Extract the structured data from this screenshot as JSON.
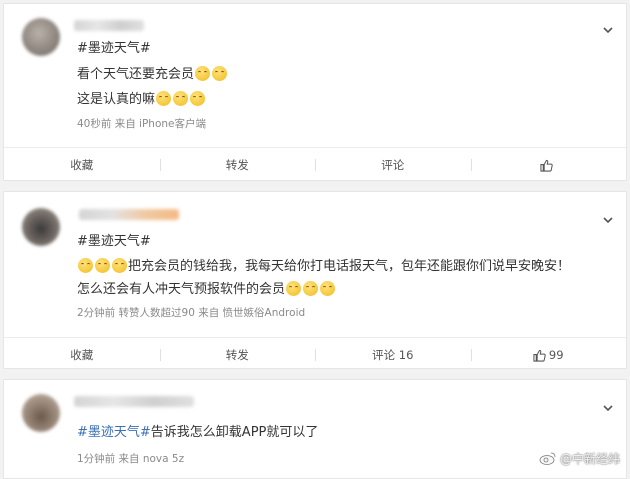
{
  "posts": [
    {
      "hashtag": "#墨迹天气#",
      "line1_text": "看个天气还要充会员",
      "line2_text": "这是认真的嘛",
      "meta": "40秒前  来自 iPhone客户端",
      "actions": {
        "favorite": "收藏",
        "forward": "转发",
        "comment": "评论",
        "like": ""
      }
    },
    {
      "hashtag": "#墨迹天气#",
      "line1_text": "把充会员的钱给我，我每天给你打电话报天气，包年还能跟你们说早安晚安！",
      "line2_text": "怎么还会有人冲天气预报软件的会员",
      "meta": "2分钟前  转赞人数超过90  来自 愤世嫉俗Android",
      "actions": {
        "favorite": "收藏",
        "forward": "转发",
        "comment": "评论 16",
        "like": "99"
      }
    },
    {
      "hashtag": "#墨迹天气#",
      "line1_text": "告诉我怎么卸载APP就可以了",
      "meta": "1分钟前  来自 nova 5z"
    }
  ],
  "watermark": "@中新经纬",
  "icons": {
    "chevron": "chevron-down-icon",
    "like": "thumbs-up-icon",
    "emoji": "grimace-emoji-icon",
    "watermark_logo": "weibo-logo-icon"
  },
  "colors": {
    "hashtag": "#3b6fb6",
    "meta": "#8a8a8a",
    "background": "#f2f2f2"
  }
}
